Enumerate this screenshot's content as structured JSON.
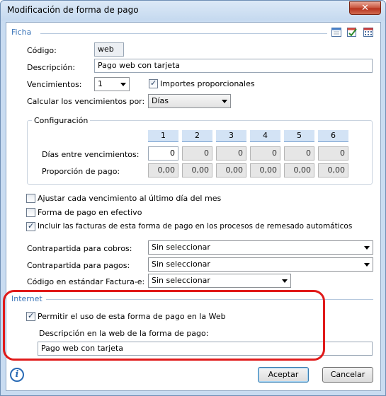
{
  "window": {
    "title": "Modificación de forma de pago",
    "close_glyph": "✕"
  },
  "ficha": {
    "title": "Ficha",
    "icons": [
      "calendar-icon",
      "checklist-icon",
      "grid-calendar-icon"
    ],
    "codigo_label": "Código:",
    "codigo_value": "web",
    "descripcion_label": "Descripción:",
    "descripcion_value": "Pago web con tarjeta",
    "vencimientos_label": "Vencimientos:",
    "vencimientos_value": "1",
    "importes_label": "Importes proporcionales",
    "importes_checked": true,
    "calcular_label": "Calcular los vencimientos por:",
    "calcular_value": "Días"
  },
  "configuracion": {
    "title": "Configuración",
    "columns": [
      "1",
      "2",
      "3",
      "4",
      "5",
      "6"
    ],
    "dias_label": "Días entre vencimientos:",
    "dias_values": [
      "0",
      "0",
      "0",
      "0",
      "0",
      "0"
    ],
    "proporcion_label": "Proporción de pago:",
    "proporcion_values": [
      "0,00",
      "0,00",
      "0,00",
      "0,00",
      "0,00",
      "0,00"
    ]
  },
  "options": [
    {
      "label": "Ajustar cada vencimiento al último día del mes",
      "checked": false
    },
    {
      "label": "Forma de pago en efectivo",
      "checked": false
    },
    {
      "label": "Incluir las facturas de esta forma de pago en los procesos de remesado automáticos",
      "checked": true
    }
  ],
  "contrapartidas": {
    "cobros_label": "Contrapartida para cobros:",
    "cobros_value": "Sin seleccionar",
    "pagos_label": "Contrapartida para pagos:",
    "pagos_value": "Sin seleccionar",
    "facturae_label": "Código en estándar Factura-e:",
    "facturae_value": "Sin seleccionar"
  },
  "internet": {
    "title": "Internet",
    "permitir_label": "Permitir el uso de esta forma de pago en la Web",
    "permitir_checked": true,
    "desc_web_label": "Descripción en la web de la forma de pago:",
    "desc_web_value": "Pago web con tarjeta"
  },
  "footer": {
    "info_glyph": "i",
    "aceptar_label": "Aceptar",
    "cancelar_label": "Cancelar"
  },
  "colors": {
    "accent": "#3a74b8",
    "highlight": "#e01a1a",
    "header_fill": "#d3e3f5"
  }
}
